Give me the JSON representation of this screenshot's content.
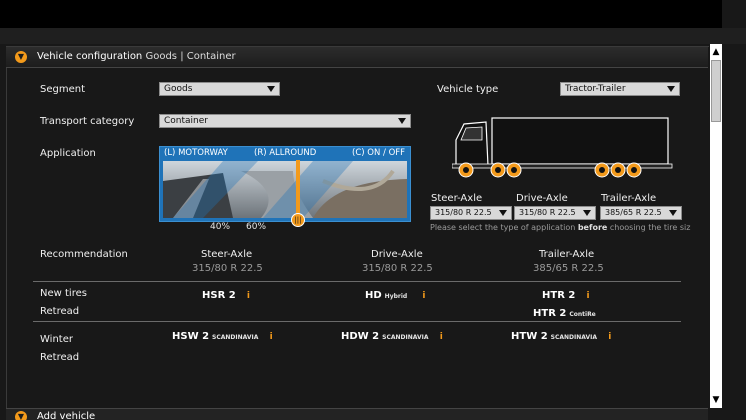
{
  "header": {
    "title": "Vehicle configuration",
    "breadcrumb": "Goods | Container"
  },
  "form": {
    "segment_label": "Segment",
    "segment_value": "Goods",
    "vehicle_type_label": "Vehicle type",
    "vehicle_type_value": "Tractor-Trailer",
    "transport_label": "Transport category",
    "transport_value": "Container",
    "application_label": "Application"
  },
  "application": {
    "tabs": [
      "(L) MOTORWAY",
      "(R) ALLROUND",
      "(C) ON / OFF"
    ],
    "left_pct": "40%",
    "right_pct": "60%",
    "slider_fraction": 0.4
  },
  "axles": {
    "steer_label": "Steer-Axle",
    "steer_size": "315/80 R 22.5",
    "drive_label": "Drive-Axle",
    "drive_size": "315/80 R 22.5",
    "trailer_label": "Trailer-Axle",
    "trailer_size": "385/65 R 22.5",
    "hint_pre": "Please select the type of application ",
    "hint_bold": "before",
    "hint_post": " choosing the tire siz"
  },
  "recommendation": {
    "label": "Recommendation",
    "steer_label": "Steer-Axle",
    "steer_size": "315/80 R 22.5",
    "drive_label": "Drive-Axle",
    "drive_size": "315/80 R 22.5",
    "trailer_label": "Trailer-Axle",
    "trailer_size": "385/65 R 22.5"
  },
  "tires": {
    "new_label": "New tires",
    "retread_label": "Retread",
    "winter_label": "Winter",
    "winter_retread_label": "Retread",
    "new_steer": "HSR 2",
    "new_drive": "HD",
    "new_drive_sub": "Hybrid",
    "new_trailer": "HTR 2",
    "retread_trailer": "HTR 2",
    "retread_trailer_sub": "ContiRe",
    "winter_steer": "HSW 2",
    "winter_steer_sub": "SCANDINAVIA",
    "winter_drive": "HDW 2",
    "winter_drive_sub": "SCANDINAVIA",
    "winter_trailer": "HTW 2",
    "winter_trailer_sub": "SCANDINAVIA",
    "info_glyph": "i"
  },
  "footer": {
    "title": "Add vehicle"
  },
  "colors": {
    "accent": "#f39a1b",
    "panel_bg": "#181818",
    "app_blue": "#1f73b8"
  },
  "icons": [
    "chevron-down-icon",
    "truck-icon",
    "info-icon",
    "scroll-up-icon",
    "scroll-down-icon",
    "grip-icon"
  ]
}
